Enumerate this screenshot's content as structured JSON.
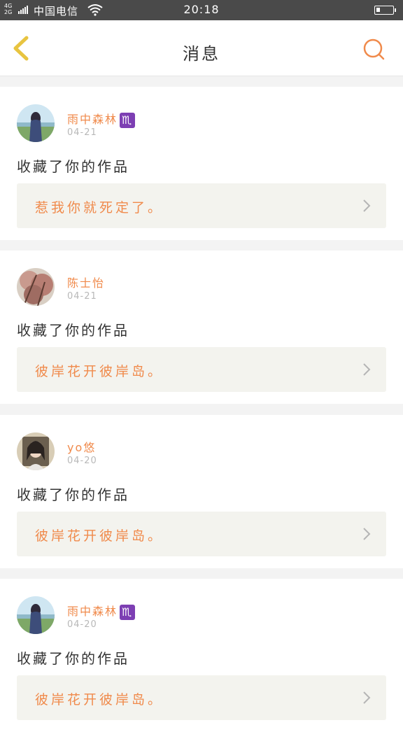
{
  "status_bar": {
    "network_top": "4G",
    "network_bottom": "2G",
    "carrier": "中国电信",
    "time": "20:18",
    "wifi_icon": "wifi-icon",
    "battery_level": 0.25
  },
  "header": {
    "title": "消息",
    "back_icon": "chevron-left-icon",
    "search_icon": "search-icon",
    "accent_color": "#f08a4b",
    "back_color": "#e8c440"
  },
  "messages": [
    {
      "username": "雨中森林",
      "badge": "♏",
      "date": "04-21",
      "action": "收藏了你的作品",
      "quote": "惹我你就死定了。",
      "avatar": "avatar-girl-field"
    },
    {
      "username": "陈士怡",
      "date": "04-21",
      "action": "收藏了你的作品",
      "quote": "彼岸花开彼岸岛。",
      "avatar": "avatar-blossom"
    },
    {
      "username": "yo悠",
      "date": "04-20",
      "action": "收藏了你的作品",
      "quote": "彼岸花开彼岸岛。",
      "avatar": "avatar-portrait"
    },
    {
      "username": "雨中森林",
      "badge": "♏",
      "date": "04-20",
      "action": "收藏了你的作品",
      "quote": "彼岸花开彼岸岛。",
      "avatar": "avatar-girl-field"
    }
  ]
}
